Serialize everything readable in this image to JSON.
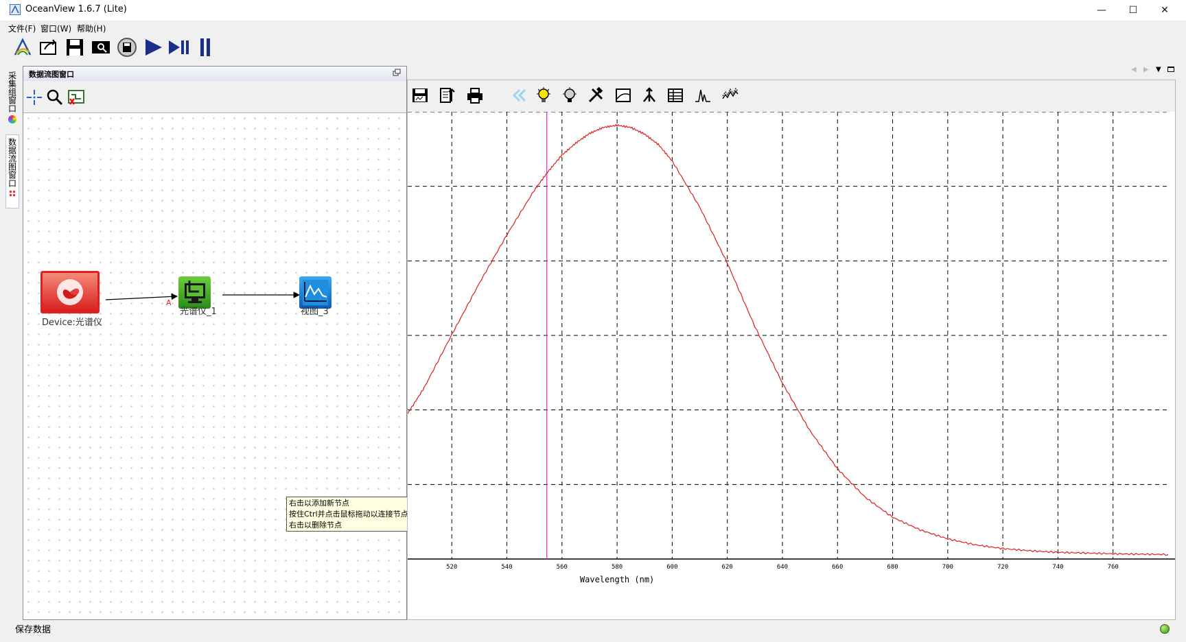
{
  "window": {
    "title": "OceanView 1.6.7 (Lite)",
    "minimize_glyph": "—",
    "maximize_glyph": "☐",
    "close_glyph": "✕"
  },
  "menu": {
    "items": [
      "文件(F)",
      "窗口(W)",
      "帮助(H)"
    ]
  },
  "toolbar": {
    "icons": [
      "wizard-icon",
      "open-icon",
      "save-icon",
      "save-search-icon",
      "disk-icon",
      "play-icon",
      "play-pause-icon",
      "pause-icon"
    ]
  },
  "side_tabs": {
    "acquisition": "采集组窗口",
    "dataflow": "数据流图窗口"
  },
  "dataflow": {
    "title": "数据流图窗口",
    "tools": [
      "select-icon",
      "zoom-icon",
      "remove-connection-icon"
    ],
    "nodes": {
      "device": "Device:光谱仪",
      "spectrometer": "光谱仪_1",
      "view": "视图_3"
    },
    "connector_label": "A",
    "tooltip": {
      "line1": "右击以添加新节点",
      "line2": "按住Ctrl并点击鼠标拖动以连接节点",
      "line3": "右击以删除节点"
    }
  },
  "graph": {
    "tools": [
      "save-graph-icon",
      "copy-graph-icon",
      "print-icon",
      "back-icon",
      "bulb-on-icon",
      "bulb-off-icon",
      "tools-icon",
      "scale-icon",
      "peak-marker-icon",
      "table-icon",
      "peak-icon",
      "overlay-icon"
    ]
  },
  "chart_data": {
    "type": "line",
    "xlabel": "Wavelength (nm)",
    "ylabel": "",
    "xlim": [
      504,
      780
    ],
    "ylim": [
      0,
      6000
    ],
    "x_ticks": [
      520,
      540,
      560,
      580,
      600,
      620,
      640,
      660,
      680,
      700,
      720,
      740,
      760
    ],
    "y_gridlines": [
      1000,
      2000,
      3000,
      4000,
      5000,
      6000
    ],
    "grid": true,
    "cursor_x": 554.5,
    "series": [
      {
        "color": "#e21b1b",
        "x": [
          504,
          510,
          520,
          530,
          540,
          550,
          555,
          560,
          565,
          570,
          575,
          580,
          585,
          590,
          595,
          600,
          610,
          620,
          630,
          640,
          650,
          660,
          670,
          680,
          690,
          700,
          710,
          720,
          730,
          740,
          750,
          760,
          770,
          780
        ],
        "y": [
          1950,
          2300,
          3010,
          3700,
          4350,
          4950,
          5200,
          5420,
          5580,
          5710,
          5790,
          5820,
          5790,
          5700,
          5560,
          5340,
          4720,
          3970,
          3120,
          2360,
          1720,
          1210,
          830,
          560,
          390,
          270,
          190,
          140,
          110,
          90,
          80,
          70,
          65,
          60
        ]
      }
    ]
  }
}
